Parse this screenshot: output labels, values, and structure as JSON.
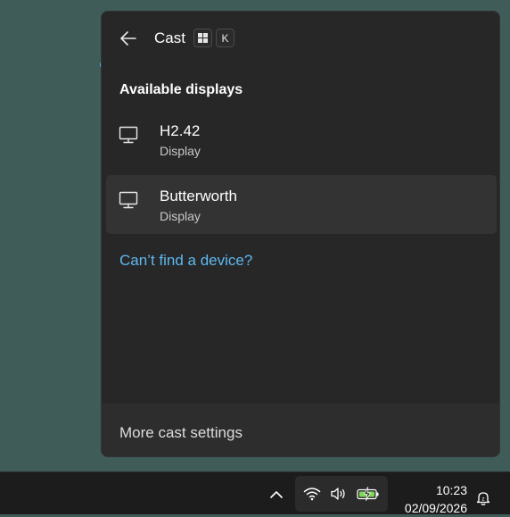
{
  "panel": {
    "title": "Cast",
    "shortcut_win": "win-key-icon",
    "shortcut_key": "K",
    "section_title": "Available displays",
    "devices": [
      {
        "name": "H2.42",
        "type": "Display",
        "icon": "monitor-icon",
        "selected": false
      },
      {
        "name": "Butterworth",
        "type": "Display",
        "icon": "monitor-icon",
        "selected": true
      }
    ],
    "help_link": "Can’t find a device?",
    "footer_label": "More cast settings"
  },
  "taskbar": {
    "time": "10:23",
    "date": "02/09/2026",
    "icons": [
      "chevron-up-icon",
      "wifi-icon",
      "volume-icon",
      "battery-charging-icon",
      "notification-bell-icon"
    ]
  },
  "colors": {
    "desktop": "#3f5c58",
    "panel_bg": "#272727",
    "link": "#5eb8f0",
    "battery_accent": "#7ed957"
  }
}
